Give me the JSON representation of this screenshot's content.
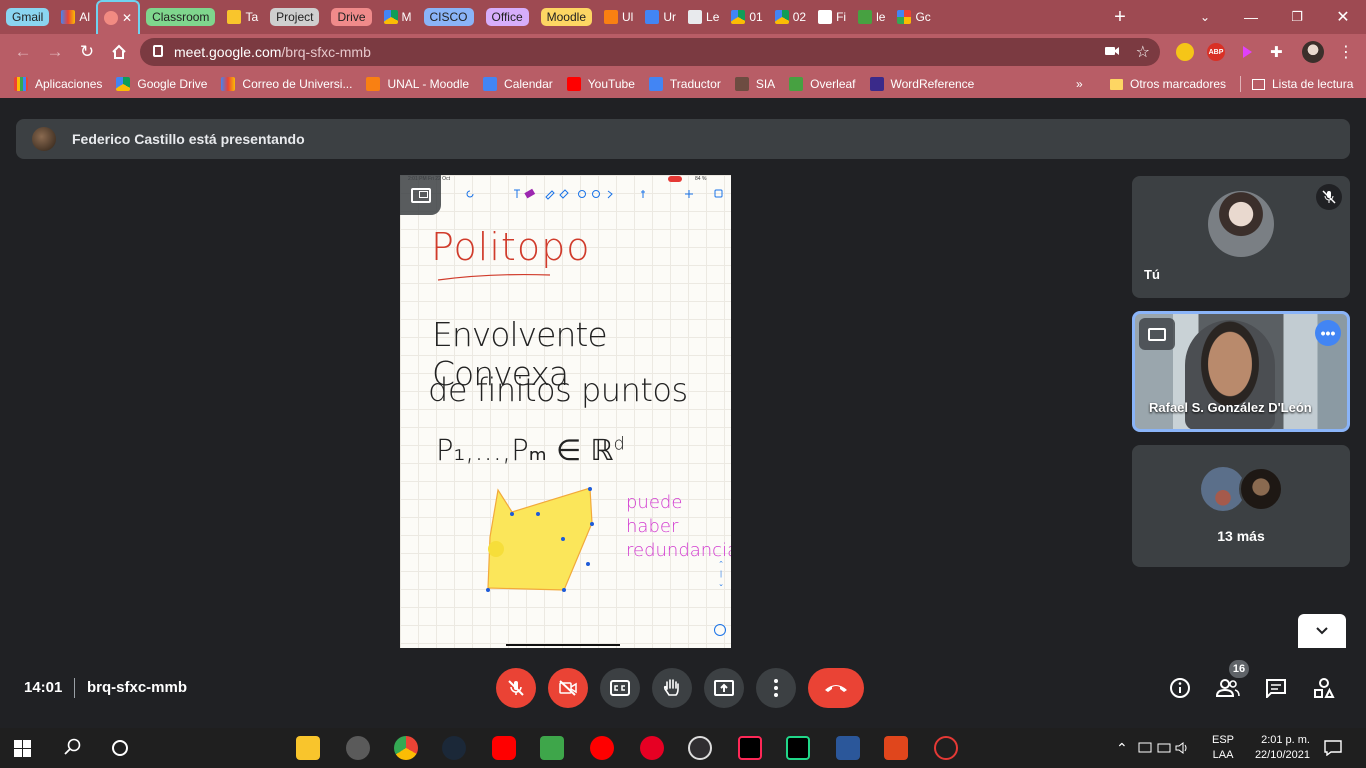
{
  "browser": {
    "tabs": [
      {
        "label": "Gmail",
        "pill_color": "#8ad5f0"
      },
      {
        "label": "Al",
        "icon": "gmail-icon"
      },
      {
        "label": "",
        "icon": "meet-record-icon",
        "active": true
      },
      {
        "label": "Classroom",
        "pill_color": "#7fd68d"
      },
      {
        "label": "Ta",
        "icon": "classroom-icon"
      },
      {
        "label": "Project",
        "pill_color": "#cfcfcf"
      },
      {
        "label": "Drive",
        "pill_color": "#f08a8a"
      },
      {
        "label": "M",
        "icon": "drive-icon"
      },
      {
        "label": "CISCO",
        "pill_color": "#8ab4f8"
      },
      {
        "label": "Office",
        "pill_color": "#d7aefb"
      },
      {
        "label": "Moodle",
        "pill_color": "#fdd663"
      },
      {
        "label": "Ul",
        "icon": "moodle-icon"
      },
      {
        "label": "Ur",
        "icon": "calendar-icon"
      },
      {
        "label": "Le",
        "icon": "doc-icon"
      },
      {
        "label": "01",
        "icon": "drive-icon"
      },
      {
        "label": "02",
        "icon": "drive-icon"
      },
      {
        "label": "Fi",
        "icon": "e-icon"
      },
      {
        "label": "le",
        "icon": "overleaf-icon"
      },
      {
        "label": "Gc",
        "icon": "google-icon"
      }
    ],
    "url_host": "meet.google.com",
    "url_path": "/brq-sfxc-mmb",
    "bookmarks": [
      {
        "label": "Aplicaciones",
        "icon": "apps-grid-icon"
      },
      {
        "label": "Google Drive",
        "icon": "drive-icon"
      },
      {
        "label": "Correo de Universi...",
        "icon": "gmail-icon"
      },
      {
        "label": "UNAL - Moodle",
        "icon": "moodle-icon"
      },
      {
        "label": "Calendar",
        "icon": "calendar-icon"
      },
      {
        "label": "YouTube",
        "icon": "youtube-icon"
      },
      {
        "label": "Traductor",
        "icon": "translate-icon"
      },
      {
        "label": "SIA",
        "icon": "sia-icon"
      },
      {
        "label": "Overleaf",
        "icon": "overleaf-icon"
      },
      {
        "label": "WordReference",
        "icon": "wordreference-icon"
      }
    ],
    "other_bookmarks": "Otros marcadores",
    "reading_list": "Lista de lectura",
    "overflow": "»"
  },
  "meet": {
    "presenting_banner": "Federico Castillo está presentando",
    "slide": {
      "status_left": "2:01 PM   Fri 22 Oct",
      "status_right": "84 %",
      "title": "Politopo",
      "line1": "Envolvente Convexa",
      "line2": "de finitos puntos",
      "line3": "P₁,...,Pₘ ∈ ℝ",
      "sup": "d",
      "note1": "puede",
      "note2": "haber",
      "note3": "redundancia"
    },
    "participants": {
      "you_label": "Tú",
      "pinned_name": "Rafael S. González D'León",
      "more_label": "13 más"
    },
    "time": "14:01",
    "meeting_code": "brq-sfxc-mmb",
    "participant_count": "16"
  },
  "taskbar": {
    "lang_top": "ESP",
    "lang_bottom": "LAA",
    "clock_time": "2:01 p. m.",
    "clock_date": "22/10/2021"
  },
  "colors": {
    "chrome_dark": "#9e4a52",
    "chrome_mid": "#b85d66",
    "meet_bg": "#202124",
    "tile_bg": "#3c4043",
    "red_button": "#ea4335",
    "accent_blue": "#8ab4f8"
  }
}
